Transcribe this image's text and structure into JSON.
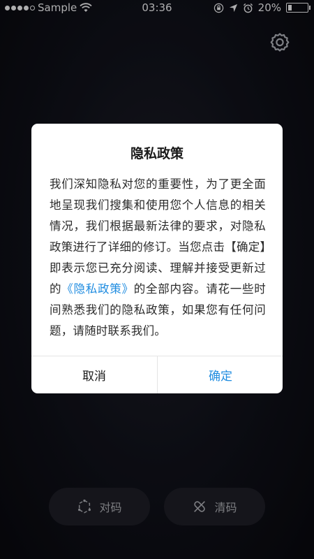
{
  "status_bar": {
    "carrier": "Sample",
    "time": "03:36",
    "battery": "20%",
    "battery_level": 0.2
  },
  "dialog": {
    "title": "隐私政策",
    "body_before_link": "我们深知隐私对您的重要性，为了更全面地呈现我们搜集和使用您个人信息的相关情况，我们根据最新法律的要求，对隐私政策进行了详细的修订。当您点击【确定】即表示您已充分阅读、理解并接受更新过的",
    "body_link": "《隐私政策》",
    "body_after_link": "的全部内容。请花一些时间熟悉我们的隐私政策，如果您有任何问题，请随时联系我们。",
    "cancel_label": "取消",
    "confirm_label": "确定",
    "link_color": "#1f8ce0"
  },
  "bottom_buttons": {
    "pair_label": "对码",
    "clear_label": "清码"
  },
  "icons": {
    "settings": "gear-icon",
    "pair": "pair-icon",
    "clear": "clear-code-icon"
  }
}
